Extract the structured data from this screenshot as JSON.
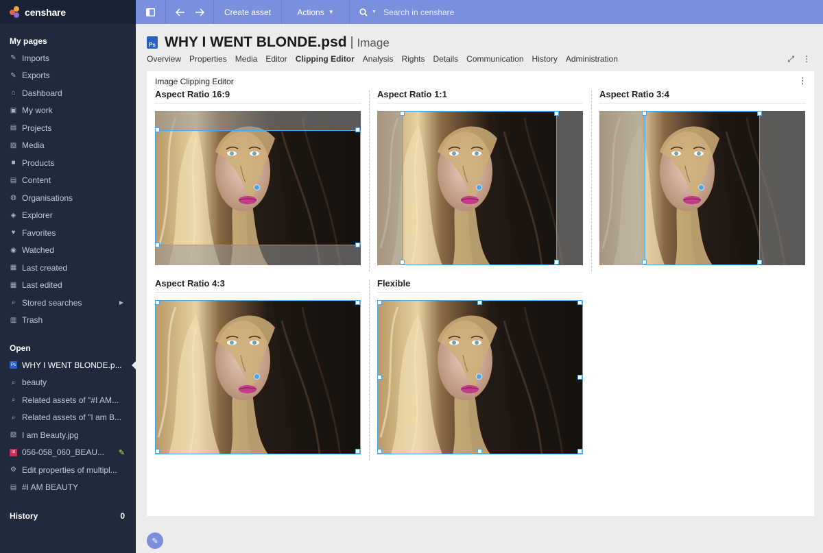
{
  "app": {
    "brand": "censhare"
  },
  "sidebar": {
    "my_pages_title": "My pages",
    "items": [
      {
        "label": "Imports",
        "icon": "import-icon"
      },
      {
        "label": "Exports",
        "icon": "export-icon"
      },
      {
        "label": "Dashboard",
        "icon": "home-icon"
      },
      {
        "label": "My work",
        "icon": "inbox-icon"
      },
      {
        "label": "Projects",
        "icon": "projects-icon"
      },
      {
        "label": "Media",
        "icon": "image-icon"
      },
      {
        "label": "Products",
        "icon": "box-icon"
      },
      {
        "label": "Content",
        "icon": "document-icon"
      },
      {
        "label": "Organisations",
        "icon": "globe-icon"
      },
      {
        "label": "Explorer",
        "icon": "compass-icon"
      },
      {
        "label": "Favorites",
        "icon": "heart-icon"
      },
      {
        "label": "Watched",
        "icon": "eye-icon"
      },
      {
        "label": "Last created",
        "icon": "created-icon"
      },
      {
        "label": "Last edited",
        "icon": "edited-icon"
      },
      {
        "label": "Stored searches",
        "icon": "search-icon"
      },
      {
        "label": "Trash",
        "icon": "trash-icon"
      }
    ],
    "open_title": "Open",
    "open_items": [
      {
        "label": "WHY I WENT BLONDE.p...",
        "icon": "psd-icon"
      },
      {
        "label": "beauty",
        "icon": "search-icon"
      },
      {
        "label": "Related assets of \"#I AM...",
        "icon": "search-icon"
      },
      {
        "label": "Related assets of \"I am B...",
        "icon": "search-icon"
      },
      {
        "label": "I am Beauty.jpg",
        "icon": "image-icon"
      },
      {
        "label": "056-058_060_BEAU...",
        "icon": "indesign-icon"
      },
      {
        "label": "Edit properties of multipl...",
        "icon": "gear-icon"
      },
      {
        "label": "#I AM BEAUTY",
        "icon": "document-icon"
      }
    ],
    "history_title": "History",
    "history_count": "0"
  },
  "topbar": {
    "create_label": "Create asset",
    "actions_label": "Actions",
    "search_placeholder": "Search in censhare"
  },
  "header": {
    "title": "WHY I WENT BLONDE.psd",
    "separator": "|",
    "type": "Image",
    "file_badge": "Ps",
    "tabs": [
      "Overview",
      "Properties",
      "Media",
      "Editor",
      "Clipping Editor",
      "Analysis",
      "Rights",
      "Details",
      "Communication",
      "History",
      "Administration"
    ],
    "active_tab": "Clipping Editor"
  },
  "panel": {
    "title": "Image Clipping Editor",
    "crops": [
      {
        "title": "Aspect Ratio 16:9"
      },
      {
        "title": "Aspect Ratio 1:1"
      },
      {
        "title": "Aspect Ratio 3:4"
      },
      {
        "title": "Aspect Ratio 4:3"
      },
      {
        "title": "Flexible"
      }
    ]
  },
  "colors": {
    "sidebar": "#1f2a3c",
    "topbar": "#7b8fdc",
    "crop": "#4aa7ea"
  }
}
